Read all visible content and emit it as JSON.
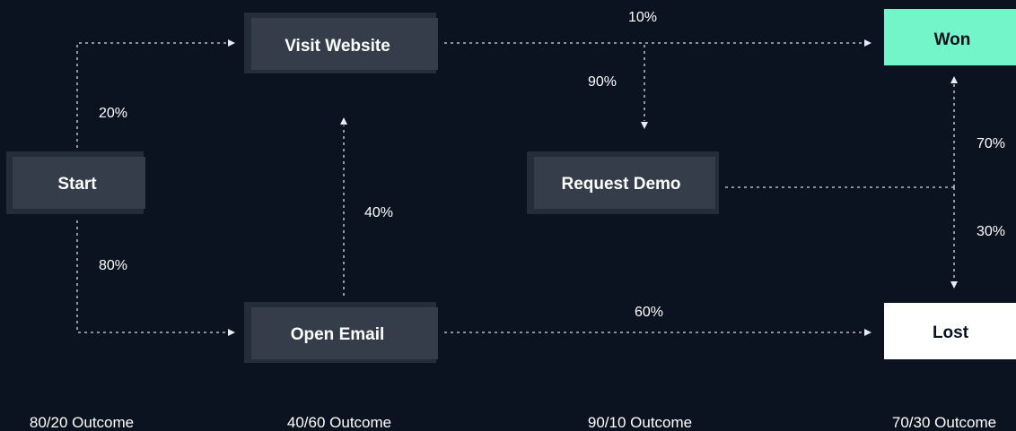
{
  "nodes": {
    "start": "Start",
    "visit_website": "Visit Website",
    "open_email": "Open Email",
    "request_demo": "Request Demo",
    "won": "Won",
    "lost": "Lost"
  },
  "edges": {
    "start_to_visit": "20%",
    "start_to_email": "80%",
    "email_to_visit": "40%",
    "email_to_lost": "60%",
    "visit_to_won": "10%",
    "visit_to_demo": "90%",
    "demo_to_won": "70%",
    "demo_to_lost": "30%"
  },
  "outcomes": [
    "80/20 Outcome",
    "40/60 Outcome",
    "90/10 Outcome",
    "70/30 Outcome"
  ],
  "colors": {
    "background": "#0b1220",
    "node_fill": "#343d49",
    "won_fill": "#73f5c9",
    "lost_fill": "#ffffff",
    "edge": "#d7dde5"
  }
}
